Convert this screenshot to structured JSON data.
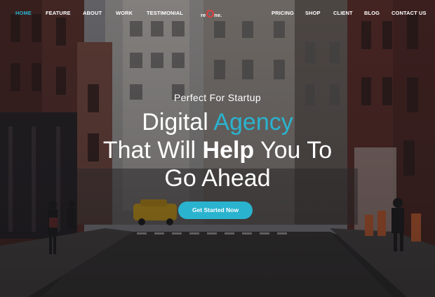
{
  "nav": {
    "home": "HOME",
    "feature": "FEATURE",
    "about": "ABOUT",
    "work": "WORK",
    "testimonial": "TESTIMONIAL",
    "pricing": "PRICING",
    "shop": "SHOP",
    "client": "CLIENT",
    "blog": "BLOG",
    "contact": "CONTACT US"
  },
  "logo": {
    "pre": "re",
    "post": "ne",
    "dot": "."
  },
  "hero": {
    "tagline": "Perfect For Startup",
    "line1_pre": "Digital ",
    "line1_accent": "Agency",
    "line2_pre": "That Will ",
    "line2_bold": "Help",
    "line2_post": " You To",
    "line3": "Go Ahead",
    "cta_label": "Get Started Now"
  },
  "colors": {
    "accent": "#2ab3cf",
    "logo_o": "#e03d3d",
    "text": "#ffffff"
  }
}
